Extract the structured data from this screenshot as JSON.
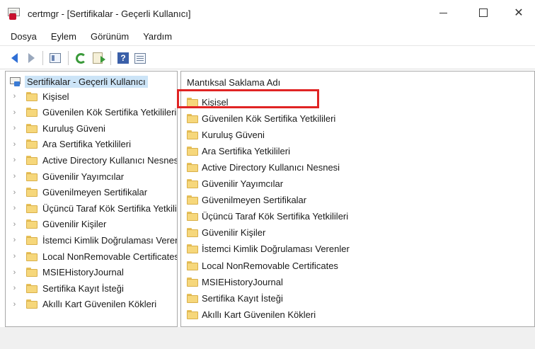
{
  "window": {
    "title": "certmgr - [Sertifikalar - Geçerli Kullanıcı]",
    "controls": {
      "minimize": "—",
      "maximize": "☐",
      "close": "✕"
    }
  },
  "menu": [
    "Dosya",
    "Eylem",
    "Görünüm",
    "Yardım"
  ],
  "toolbar": {
    "icons": [
      "back-arrow-icon",
      "forward-arrow-icon",
      "show-hide-tree-icon",
      "refresh-icon",
      "export-list-icon",
      "help-icon",
      "properties-icon"
    ],
    "help_glyph": "?"
  },
  "tree": {
    "root": "Sertifikalar - Geçerli Kullanıcı",
    "items": [
      "Kişisel",
      "Güvenilen Kök Sertifika Yetkilileri",
      "Kuruluş Güveni",
      "Ara Sertifika Yetkilileri",
      "Active Directory Kullanıcı Nesnesi",
      "Güvenilir Yayımcılar",
      "Güvenilmeyen Sertifikalar",
      "Üçüncü Taraf Kök Sertifika Yetkilileri",
      "Güvenilir Kişiler",
      "İstemci Kimlik Doğrulaması Verenler",
      "Local NonRemovable Certificates",
      "MSIEHistoryJournal",
      "Sertifika Kayıt İsteği",
      "Akıllı Kart Güvenilen Kökleri"
    ]
  },
  "list": {
    "column_header": "Mantıksal Saklama Adı",
    "items": [
      "Kişisel",
      "Güvenilen Kök Sertifika Yetkilileri",
      "Kuruluş Güveni",
      "Ara Sertifika Yetkilileri",
      "Active Directory Kullanıcı Nesnesi",
      "Güvenilir Yayımcılar",
      "Güvenilmeyen Sertifikalar",
      "Üçüncü Taraf Kök Sertifika Yetkilileri",
      "Güvenilir Kişiler",
      "İstemci Kimlik Doğrulaması Verenler",
      "Local NonRemovable Certificates",
      "MSIEHistoryJournal",
      "Sertifika Kayıt İsteği",
      "Akıllı Kart Güvenilen Kökleri"
    ],
    "highlighted_item": "Kişisel"
  },
  "colors": {
    "selection": "#cce4f7",
    "highlight_box": "#e02424",
    "folder": "#f6d77b",
    "nav_arrow": "#2f6fd6"
  }
}
